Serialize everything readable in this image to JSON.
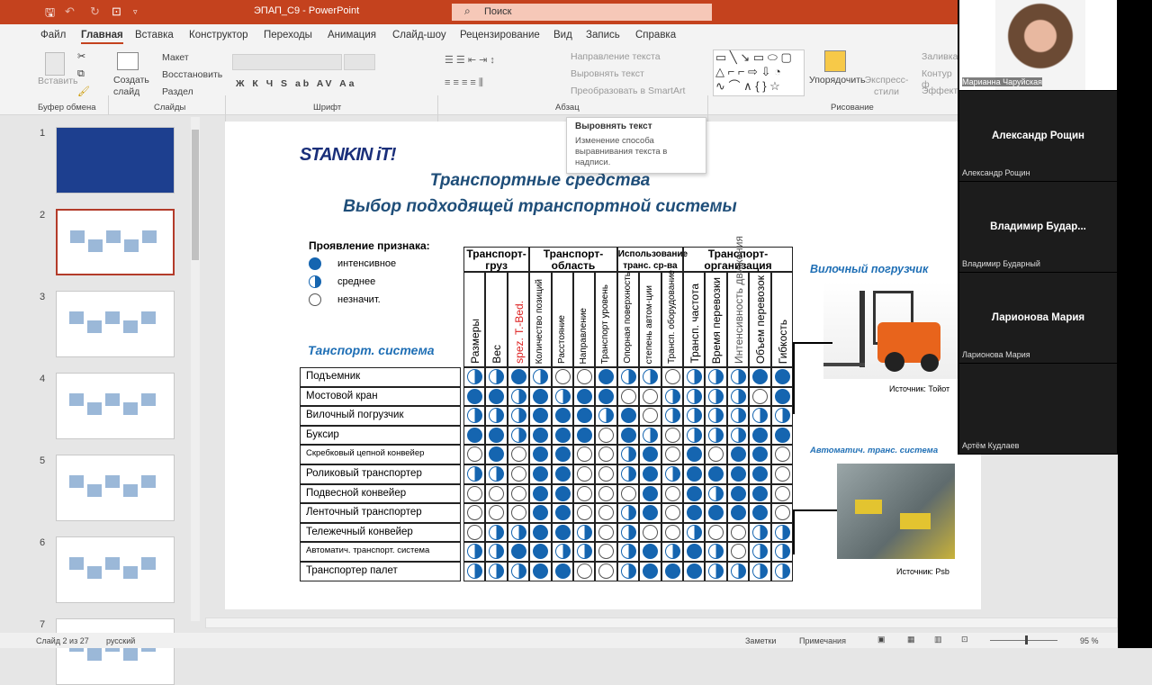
{
  "app": {
    "title": "ЭПАП_С9 - PowerPoint",
    "search_placeholder": "Поиск"
  },
  "menu": [
    "Файл",
    "Главная",
    "Вставка",
    "Конструктор",
    "Переходы",
    "Анимация",
    "Слайд-шоу",
    "Рецензирование",
    "Вид",
    "Запись",
    "Справка"
  ],
  "ribbon": {
    "paste": "Вставить",
    "clipboard": "Буфер обмена",
    "new_slide": "Создать слайд",
    "layout": "Макет",
    "reset": "Восстановить",
    "section": "Раздел",
    "slides": "Слайды",
    "font": "Шрифт",
    "font_btns": "Ж  К  Ч  S  ab  AV  Aa",
    "text_direction": "Направление текста",
    "align_text": "Выровнять текст",
    "smartart": "Преобразовать в SmartArt",
    "paragraph": "Абзац",
    "arrange": "Упорядочить",
    "quick_styles": "Экспресс-стили",
    "fill": "Заливка",
    "outline": "Контур ф",
    "effects": "Эффекты",
    "drawing": "Рисование"
  },
  "tooltip": {
    "title": "Выровнять текст",
    "body": "Изменение способа выравнивания текста в надписи."
  },
  "thumbs": [
    "1",
    "2",
    "3",
    "4",
    "5",
    "6",
    "7"
  ],
  "slide": {
    "logo": "STANKIN iT!",
    "title1": "Транспортные средства",
    "title2": "Выбор подходящей транспортной системы",
    "legend_title": "Проявление признака:",
    "legend": [
      "интенсивное",
      "среднее",
      "незначит."
    ],
    "system_label": "Танспорт. система",
    "groups": [
      "Транспорт-груз",
      "Транспорт-область",
      "Использование транс. ср-ва",
      "Транспорт-организация"
    ],
    "columns": [
      "Размеры",
      "Вес",
      "spez. T.-Bed.",
      "Количество позиций",
      "Расстояние",
      "Направление",
      "Транспорт уровень",
      "Опорная поверхность",
      "степень автом-ции",
      "Трансп. оборудование",
      "Трансп. частота",
      "Время перевозки",
      "Интенсивность движения",
      "Объем перевозок",
      "Гибкость"
    ],
    "rows": [
      {
        "name": "Подъемник",
        "v": "HHFHEEFHHEHHHFF"
      },
      {
        "name": "Мостовой кран",
        "v": "FFHFHFFEEHHHHEF"
      },
      {
        "name": "Вилочный погрузчик",
        "v": "HHHFFFHFEHHHHHH"
      },
      {
        "name": "Буксир",
        "v": "FFHFFFEFHEHHHFF"
      },
      {
        "name": "Скребковый цепной конвейер",
        "v": "EFEFFEEHFEFEFFE"
      },
      {
        "name": "Роликовый транспортер",
        "v": "HHEFFEEHFHFFFFE"
      },
      {
        "name": "Подвесной конвейер",
        "v": "EEEFFEEEFEFHFFE"
      },
      {
        "name": "Ленточный транспортер",
        "v": "EEEFFEEHFEFFFFE"
      },
      {
        "name": "Тележечный конвейер",
        "v": "EHHFFHEHEEHEEHH"
      },
      {
        "name": "Автоматич. транспорт. система",
        "v": "HHFFHHEHFHFHEHH"
      },
      {
        "name": "Транспортер палет",
        "v": "HHHFFEEHFFFHHHH"
      }
    ],
    "forklift_title": "Вилочный погрузчик",
    "forklift_src": "Источник: Тойот",
    "ats_title": "Автоматич. транс. система",
    "ats_src": "Источник: Psb"
  },
  "participants": [
    {
      "tile": "",
      "label": "Марианна Чаруйская"
    },
    {
      "tile": "Александр Рощин",
      "label": "Александр Рощин"
    },
    {
      "tile": "Владимир  Будар...",
      "label": "Владимир Бударный"
    },
    {
      "tile": "Ларионова Мария",
      "label": "Ларионова Мария"
    },
    {
      "tile": "",
      "label": "Артём Кудлаев"
    }
  ],
  "status": {
    "slide": "Слайд 2 из 27",
    "lang": "русский",
    "notes": "Заметки",
    "comments": "Примечания",
    "zoom": "95 %"
  },
  "colors": {
    "accent": "#c4421e",
    "blue": "#1565b0"
  }
}
